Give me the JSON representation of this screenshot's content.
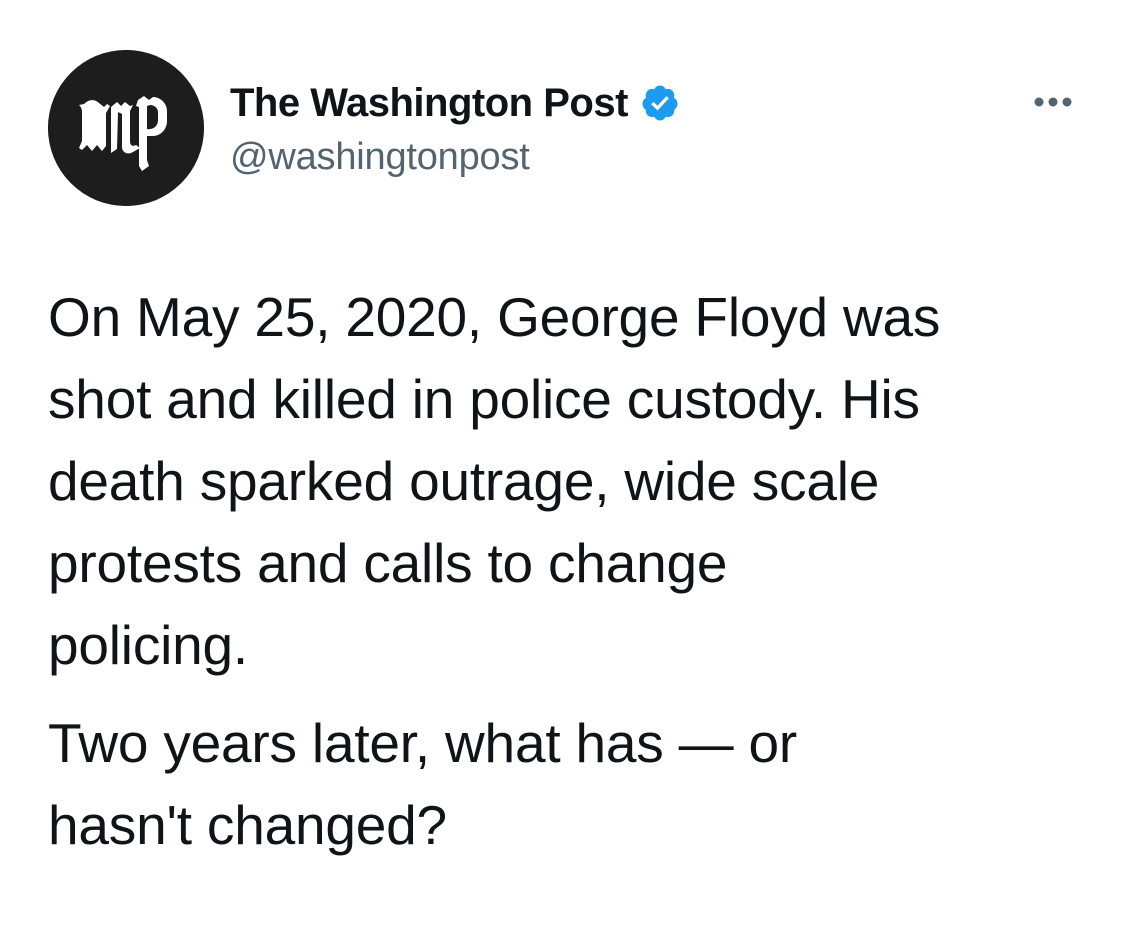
{
  "account": {
    "display_name": "The Washington Post",
    "handle": "@washingtonpost",
    "avatar_icon": "washington-post-logo-icon",
    "avatar_monogram": "wp",
    "verified_icon": "verified-badge-icon",
    "verified_color": "#1d9bf0"
  },
  "actions": {
    "more_icon": "more-options-icon"
  },
  "tweet": {
    "paragraphs": [
      "On May 25, 2020, George Floyd was\nshot and killed in police custody. His\ndeath sparked outrage, wide scale\nprotests and calls to change\npolicing.",
      "Two years later, what has — or\nhasn't changed?"
    ]
  },
  "colors": {
    "text_primary": "#0f1419",
    "text_secondary": "#536471",
    "avatar_bg": "#1d1d1d",
    "accent": "#1d9bf0"
  }
}
